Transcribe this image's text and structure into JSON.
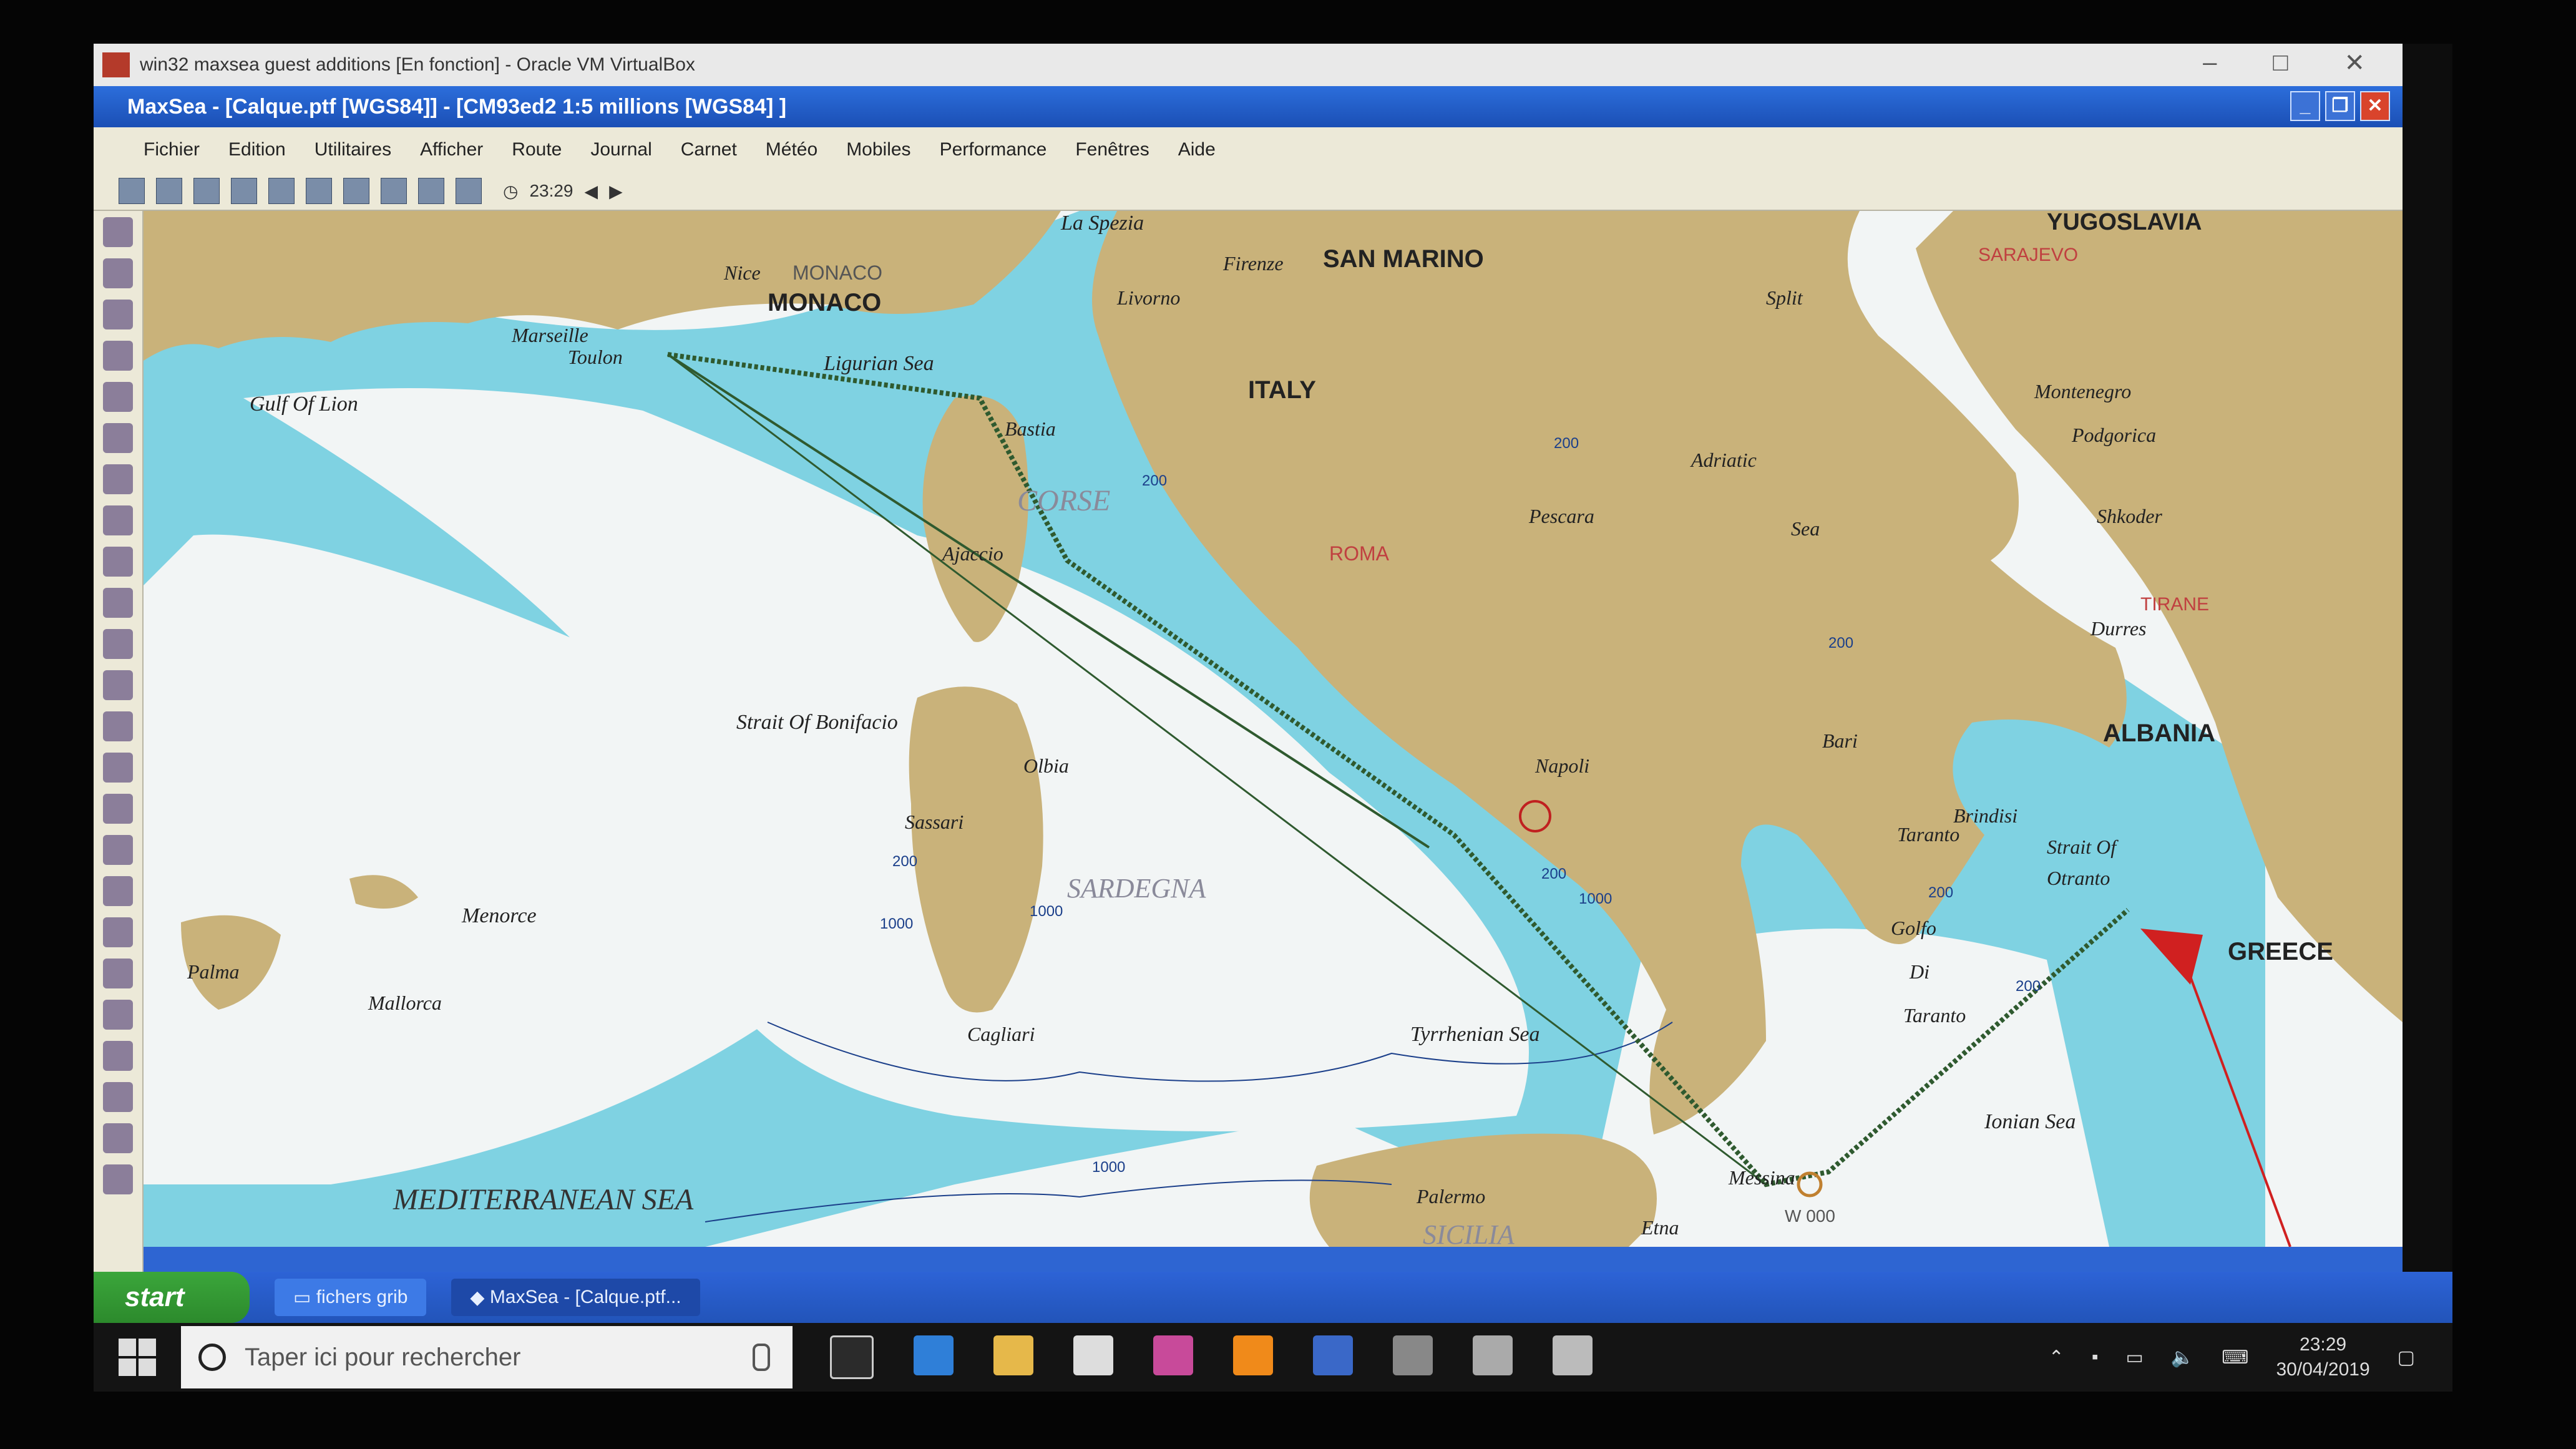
{
  "vbox": {
    "title": "win32 maxsea guest additions [En fonction] - Oracle VM VirtualBox"
  },
  "maxsea": {
    "title": "MaxSea - [Calque.ptf [WGS84]] - [CM93ed2  1:5 millions [WGS84] ]",
    "menu": [
      "Fichier",
      "Edition",
      "Utilitaires",
      "Afficher",
      "Route",
      "Journal",
      "Carnet",
      "Météo",
      "Mobiles",
      "Performance",
      "Fenêtres",
      "Aide"
    ],
    "toolbar_time": "23:29"
  },
  "map": {
    "regions": [
      "MONACO",
      "SAN MARINO",
      "ITALY",
      "ALBANIA",
      "GREECE",
      "YUGOSLAVIA"
    ],
    "seas": [
      "Ligurian Sea",
      "Tyrrhenian Sea",
      "Ionian Sea",
      "MEDITERRANEAN SEA",
      "Adriatic",
      "Sea",
      "Gulf Of Lion",
      "Strait Of Bonifacio",
      "Golfo",
      "Di",
      "Taranto",
      "Strait Of",
      "Otranto"
    ],
    "islands": [
      "CORSE",
      "SARDEGNA",
      "SICILIA",
      "Menorce",
      "Mallorca"
    ],
    "places": [
      "La Spezia",
      "Nice",
      "MONACO",
      "Marseille",
      "Toulon",
      "Livorno",
      "Firenze",
      "Bastia",
      "Ajaccio",
      "Olbia",
      "Sassari",
      "Cagliari",
      "Palma",
      "Pescara",
      "Bari",
      "Napoli",
      "Taranto",
      "Brindisi",
      "Messina",
      "Palermo",
      "Etna",
      "Split",
      "Montenegro",
      "Podgorica",
      "Shkoder",
      "Durres"
    ],
    "capitals": [
      "ROMA",
      "SARAJEVO",
      "TIRANE"
    ],
    "waypoint": "W 000",
    "depths": [
      "200",
      "200",
      "200",
      "200",
      "1000",
      "1000",
      "200",
      "200",
      "1000",
      "200",
      "1000"
    ]
  },
  "taskbar_xp": {
    "start": "start",
    "tasks": [
      "fichers grib",
      "MaxSea - [Calque.ptf..."
    ]
  },
  "taskbar_win10": {
    "search_placeholder": "Taper ici pour rechercher",
    "time": "23:29",
    "date": "30/04/2019"
  },
  "colors": {
    "land": "#c9b27a",
    "shallow": "#7fd2e2",
    "deep": "#f2f5f5",
    "route": "#2f5a2f",
    "titlebar": "#1b4fb5"
  }
}
